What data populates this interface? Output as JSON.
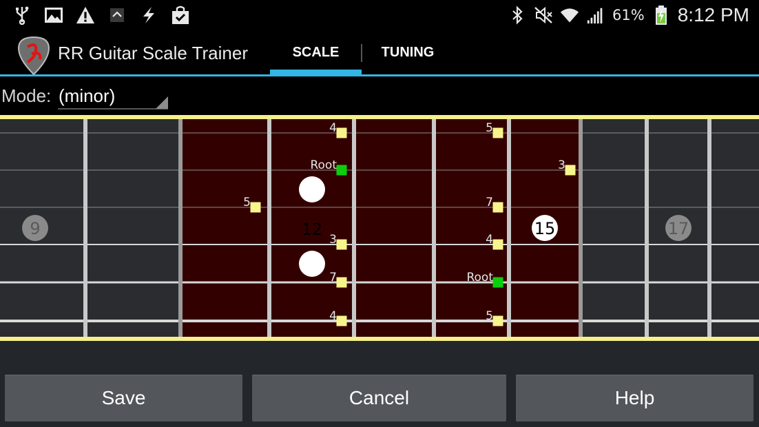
{
  "status_bar": {
    "battery_percent": "61%",
    "clock": "8:12 PM",
    "left_icons": [
      "usb-icon",
      "image-icon",
      "warning-icon",
      "upload-icon",
      "flash-icon",
      "clipboard-check-icon"
    ],
    "right_icons": [
      "bluetooth-icon",
      "mute-icon",
      "wifi-icon",
      "signal-icon",
      "battery-charging-icon"
    ]
  },
  "app_bar": {
    "title": "RR Guitar Scale Trainer",
    "logo_icon": "guitar-pick-logo-icon",
    "tabs": [
      {
        "label": "SCALE",
        "selected": true
      },
      {
        "label": "TUNING",
        "selected": false
      }
    ]
  },
  "mode": {
    "label": "Mode:",
    "value": "(minor)"
  },
  "fretboard": {
    "fret_markers": [
      {
        "label": "9",
        "style": "gray"
      },
      {
        "label": "12",
        "style": "double-dot"
      },
      {
        "label": "15",
        "style": "white"
      },
      {
        "label": "17",
        "style": "gray"
      }
    ],
    "notes": [
      {
        "label": "4",
        "string": 1,
        "fret": 12,
        "root": false
      },
      {
        "label": "5",
        "string": 1,
        "fret": 14,
        "root": false
      },
      {
        "label": "Root",
        "string": 2,
        "fret": 12,
        "root": true
      },
      {
        "label": "3",
        "string": 2,
        "fret": 15,
        "root": false
      },
      {
        "label": "5",
        "string": 3,
        "fret": 11,
        "root": false
      },
      {
        "label": "7",
        "string": 3,
        "fret": 14,
        "root": false
      },
      {
        "label": "3",
        "string": 4,
        "fret": 12,
        "root": false
      },
      {
        "label": "4",
        "string": 4,
        "fret": 14,
        "root": false
      },
      {
        "label": "7",
        "string": 5,
        "fret": 12,
        "root": false
      },
      {
        "label": "Root",
        "string": 5,
        "fret": 14,
        "root": true
      },
      {
        "label": "4",
        "string": 6,
        "fret": 12,
        "root": false
      },
      {
        "label": "5",
        "string": 6,
        "fret": 14,
        "root": false
      }
    ],
    "colors": {
      "highlight": "#330000",
      "board": "#2a2c2f",
      "border": "#f6f08a",
      "note": "#f7f48c",
      "root": "#0ccf0c",
      "fret_wire": "#c8c8c8"
    }
  },
  "buttons": {
    "save": "Save",
    "cancel": "Cancel",
    "help": "Help"
  }
}
